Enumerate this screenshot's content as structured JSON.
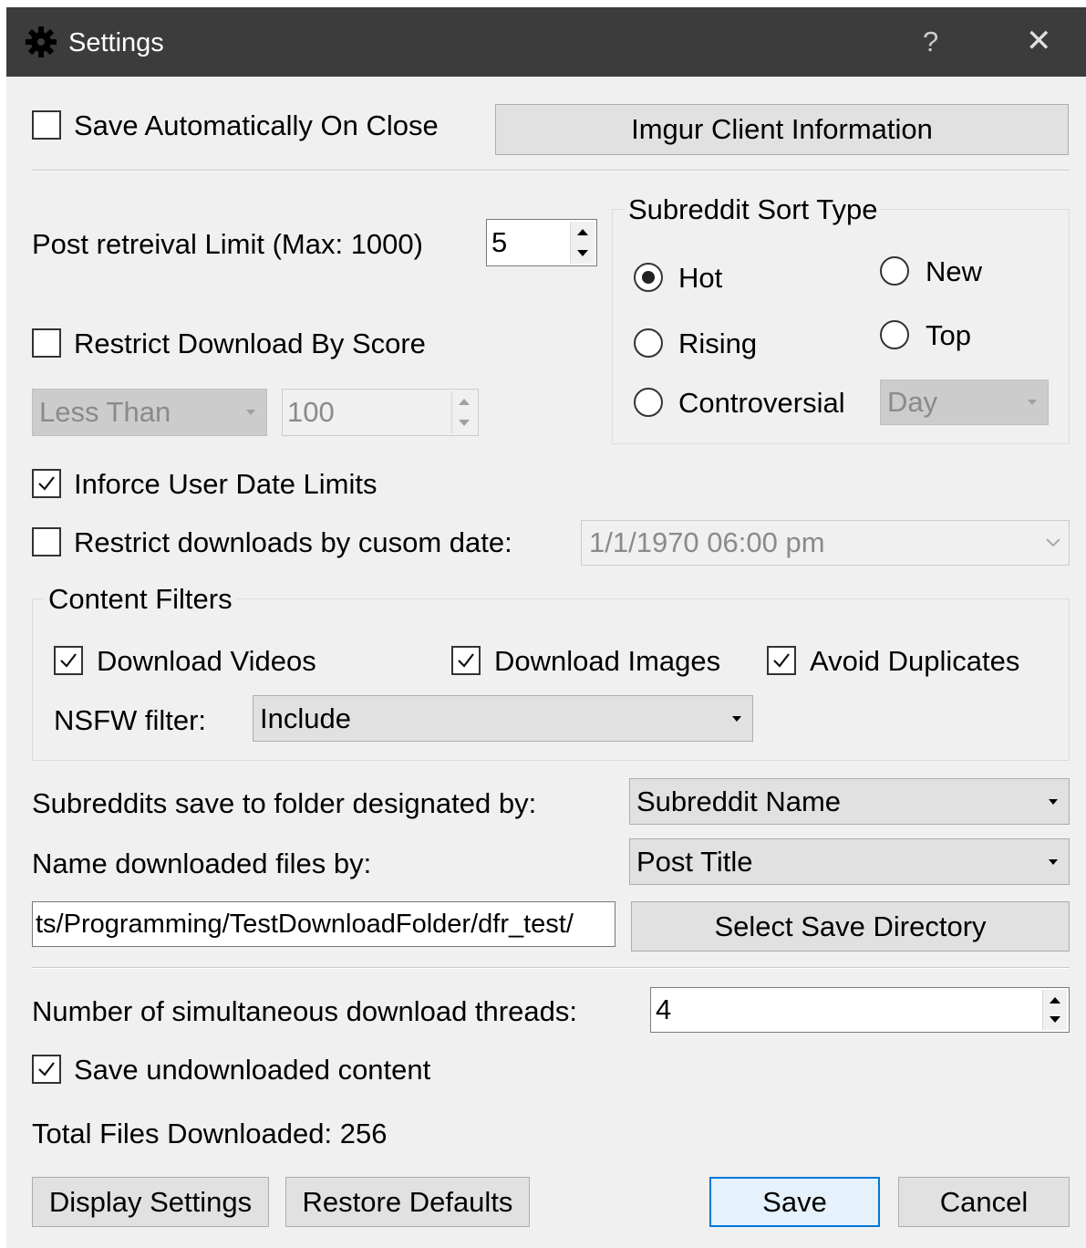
{
  "window": {
    "title": "Settings",
    "help_label": "?",
    "close_label": "✕"
  },
  "save_on_close": {
    "label": "Save Automatically On Close",
    "checked": false
  },
  "imgur_button": "Imgur Client Information",
  "post_limit": {
    "label": "Post retreival Limit (Max: 1000)",
    "value": "5"
  },
  "restrict_score": {
    "label": "Restrict Download By Score",
    "checked": false,
    "operator": "Less Than",
    "value": "100"
  },
  "sort_type": {
    "title": "Subreddit Sort Type",
    "options": {
      "hot": "Hot",
      "new": "New",
      "rising": "Rising",
      "top": "Top",
      "controversial": "Controversial"
    },
    "selected": "Hot",
    "period": "Day"
  },
  "user_date_limits": {
    "label": "Inforce User Date Limits",
    "checked": true
  },
  "custom_date": {
    "label": "Restrict downloads by cusom date:",
    "checked": false,
    "value": "1/1/1970 06:00 pm"
  },
  "content_filters": {
    "title": "Content Filters",
    "videos": {
      "label": "Download Videos",
      "checked": true
    },
    "images": {
      "label": "Download Images",
      "checked": true
    },
    "duplicates": {
      "label": "Avoid Duplicates",
      "checked": true
    },
    "nsfw_label": "NSFW filter:",
    "nsfw_value": "Include"
  },
  "folder_by": {
    "label": "Subreddits save to folder designated by:",
    "value": "Subreddit Name"
  },
  "name_by": {
    "label": "Name downloaded files by:",
    "value": "Post Title"
  },
  "save_dir": {
    "path": "ts/Programming/TestDownloadFolder/dfr_test/",
    "button": "Select Save Directory"
  },
  "threads": {
    "label": "Number of simultaneous download threads:",
    "value": "4"
  },
  "save_undownloaded": {
    "label": "Save undownloaded content",
    "checked": true
  },
  "total_files": "Total Files Downloaded: 256",
  "buttons": {
    "display_settings": "Display Settings",
    "restore_defaults": "Restore Defaults",
    "save": "Save",
    "cancel": "Cancel"
  }
}
